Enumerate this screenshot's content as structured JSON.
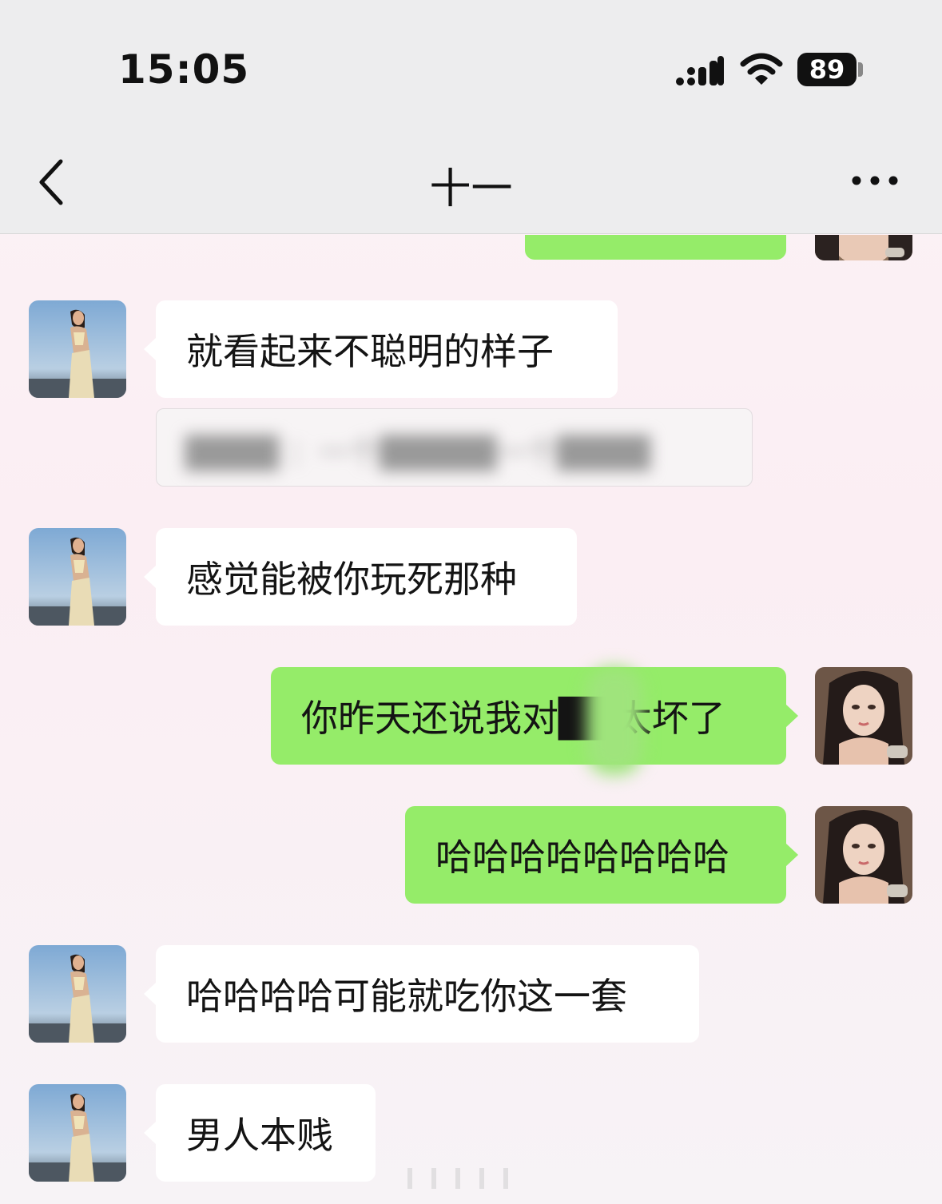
{
  "status_bar": {
    "time": "15:05",
    "battery_level": "89",
    "icons": [
      "signal-icon",
      "wifi-icon",
      "battery-icon"
    ]
  },
  "header": {
    "title": "十一",
    "back_icon": "chevron-left-icon",
    "more_icon": "more-dots-icon"
  },
  "messages": [
    {
      "side": "in",
      "text": "就看起来不聪明的样子"
    },
    {
      "side": "in-quote",
      "text": "████ ：一个█████一个████"
    },
    {
      "side": "in",
      "text": "感觉能被你玩死那种"
    },
    {
      "side": "out",
      "text": "你昨天还说我对██太坏了"
    },
    {
      "side": "out",
      "text": "哈哈哈哈哈哈哈哈"
    },
    {
      "side": "in",
      "text": "哈哈哈哈可能就吃你这一套"
    },
    {
      "side": "in",
      "text": "男人本贱"
    }
  ],
  "colors": {
    "outgoing_bubble": "#95ec69",
    "incoming_bubble": "#ffffff",
    "header_bg": "#ededee"
  }
}
